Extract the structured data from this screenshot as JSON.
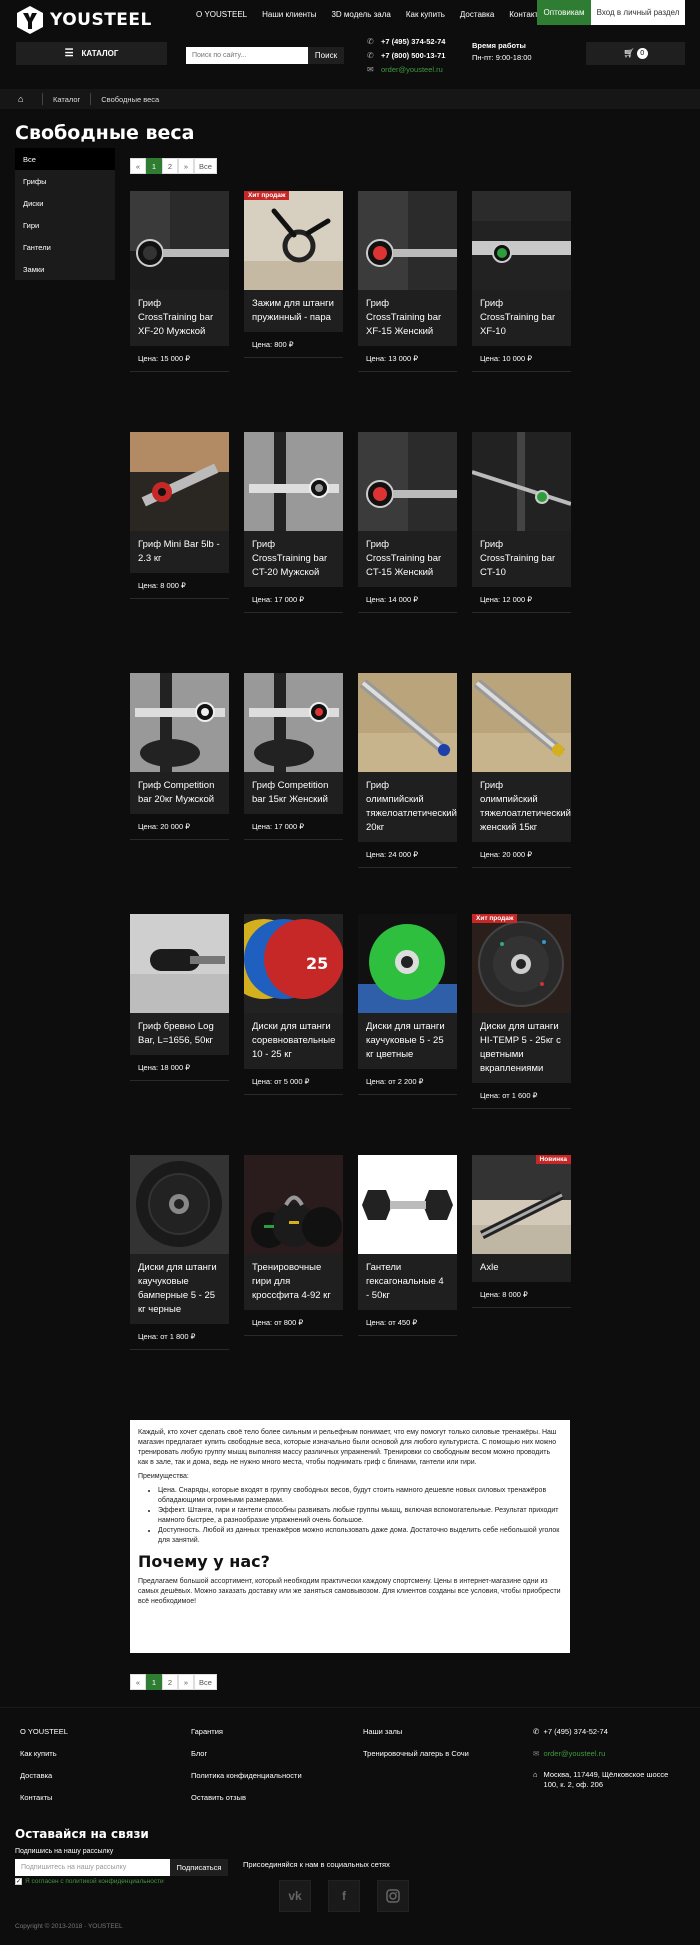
{
  "header": {
    "logo_text": "YOUSTEEL",
    "nav": [
      "О YOUSTEEL",
      "Наши клиенты",
      "3D модель зала",
      "Как купить",
      "Доставка",
      "Контакты"
    ],
    "opt_label": "Оптовикам",
    "login_label": "Вход в личный раздел",
    "catalog_label": "КАТАЛОГ",
    "search_placeholder": "Поиск по сайту...",
    "search_button": "Поиск",
    "phone1": "+7 (495) 374-52-74",
    "phone2": "+7 (800) 500-13-71",
    "email": "order@yousteel.ru",
    "hours_title": "Время работы",
    "hours_value": "Пн-пт: 9:00-18:00",
    "cart_count": "0"
  },
  "breadcrumb": [
    "Каталог",
    "Свободные веса"
  ],
  "page_title": "Свободные веса",
  "sidebar": [
    "Все",
    "Грифы",
    "Диски",
    "Гири",
    "Гантели",
    "Замки"
  ],
  "pager": [
    "«",
    "1",
    "2",
    "»",
    "Все"
  ],
  "products": [
    {
      "name": "Гриф CrossTraining bar XF-20 Мужской",
      "price": "Цена: 15 000  ₽",
      "tag": "",
      "img": "bar-black"
    },
    {
      "name": "Зажим для штанги пружинный - пара",
      "price": "Цена: 800  ₽",
      "tag": "Хит продаж",
      "img": "clip"
    },
    {
      "name": "Гриф CrossTraining bar XF-15 Женский",
      "price": "Цена: 13 000  ₽",
      "tag": "",
      "img": "bar-red"
    },
    {
      "name": "Гриф CrossTraining bar XF-10",
      "price": "Цена: 10 000  ₽",
      "tag": "",
      "img": "bar-green"
    },
    {
      "name": "Гриф Mini Bar 5lb - 2.3 кг",
      "price": "Цена: 8 000  ₽",
      "tag": "",
      "img": "minibar"
    },
    {
      "name": "Гриф CrossTraining bar CT-20 Мужской",
      "price": "Цена: 17 000  ₽",
      "tag": "",
      "img": "bar-silver"
    },
    {
      "name": "Гриф CrossTraining bar CT-15 Женский",
      "price": "Цена: 14 000  ₽",
      "tag": "",
      "img": "bar-red"
    },
    {
      "name": "Гриф CrossTraining bar CT-10",
      "price": "Цена: 12 000  ₽",
      "tag": "",
      "img": "bar-long"
    },
    {
      "name": "Гриф Competition bar 20кг Мужской",
      "price": "Цена: 20 000  ₽",
      "tag": "",
      "img": "comp-black"
    },
    {
      "name": "Гриф Competition bar 15кг Женский",
      "price": "Цена: 17 000  ₽",
      "tag": "",
      "img": "comp-red"
    },
    {
      "name": "Гриф олимпийский тяжелоатлетический 20кг",
      "price": "Цена: 24 000  ₽",
      "tag": "",
      "img": "olymp-blue"
    },
    {
      "name": "Гриф олимпийский тяжелоатлетический женский 15кг",
      "price": "Цена: 20 000  ₽",
      "tag": "",
      "img": "olymp-yellow"
    },
    {
      "name": "Гриф бревно Log Bar, L=1656, 50кг",
      "price": "Цена: 18 000  ₽",
      "tag": "",
      "img": "log"
    },
    {
      "name": "Диски для штанги соревновательные 10 - 25 кг",
      "price": "Цена: от 5 000  ₽",
      "tag": "",
      "img": "plates-color"
    },
    {
      "name": "Диски для штанги каучуковые 5 - 25 кг цветные",
      "price": "Цена: от 2 200  ₽",
      "tag": "",
      "img": "plate-green"
    },
    {
      "name": "Диски для штанги HI-TEMP 5 - 25кг с цветными вкраплениями",
      "price": "Цена: от 1 600  ₽",
      "tag": "Хит продаж",
      "img": "plate-hitemp"
    },
    {
      "name": "Диски для штанги каучуковые бамперные 5 - 25 кг черные",
      "price": "Цена: от 1 800  ₽",
      "tag": "",
      "img": "plate-black"
    },
    {
      "name": "Тренировочные гири для кроссфита 4-92 кг",
      "price": "Цена: от 800  ₽",
      "tag": "",
      "img": "kettle"
    },
    {
      "name": "Гантели гексагональные 4 - 50кг",
      "price": "Цена: от 450  ₽",
      "tag": "",
      "img": "dumbbell"
    },
    {
      "name": "Axle",
      "price": "Цена: 8 000  ₽",
      "tag": "Новинка",
      "img": "axle"
    }
  ],
  "text": {
    "p1": "Каждый, кто хочет сделать своё тело более сильным и рельефным понимает, что ему помогут только силовые тренажёры. Наш магазин предлагает купить свободные веса, которые изначально были основой для любого культуриста. С помощью них можно тренировать любую группу мышц выполняя массу различных упражнений. Тренировки со свободным весом можно проводить как в зале, так и дома, ведь не нужно много места, чтобы поднимать гриф с блинами, гантели или гири.",
    "p2": "Преимущества:",
    "li": [
      "Цена. Снаряды, которые входят в группу свободных весов, будут стоить намного дешевле новых силовых тренажёров обладающими огромными размерами.",
      "Эффект. Штанга, гири и гантели способны развивать любые группы мышц, включая вспомогательные. Результат приходит намного быстрее, а разнообразие упражнений очень большое.",
      "Доступность. Любой из данных тренажёров можно использовать даже дома. Достаточно выделить себе небольшой уголок для занятий."
    ],
    "h2": "Почему у нас?",
    "p3": "Предлагаем большой ассортимент, который необходим практически каждому спортсмену. Цены в интернет-магазине одни из самых дешёвых. Можно заказать доставку или же заняться самовывозом. Для клиентов созданы все условия, чтобы приобрести всё необходимое!"
  },
  "footer": {
    "col1": [
      "О YOUSTEEL",
      "Как купить",
      "Доставка",
      "Контакты"
    ],
    "col2": [
      "Гарантия",
      "Блог",
      "Политика конфиденциальности",
      "Оставить отзыв"
    ],
    "col3": [
      "Наши залы",
      "Тренировочный лагерь в Сочи"
    ],
    "phone": "+7 (495) 374-52-74",
    "email": "order@yousteel.ru",
    "address": "Москва, 117449, Щёлковское шоссе 100, к. 2, оф. 206",
    "subscribe_title": "Оставайся на связи",
    "subscribe_sub": "Подпишись на нашу рассылку",
    "subscribe_placeholder": "Подпишитесь на нашу рассылку",
    "subscribe_button": "Подписаться",
    "agree": "Я согласен с политикой конфиденциальности",
    "social_title": "Присоединяйся к нам в социальных сетях",
    "social": [
      "vk",
      "f",
      "ig"
    ],
    "copyright": "Copyright © 2013-2018 · YOUSTEEL"
  }
}
